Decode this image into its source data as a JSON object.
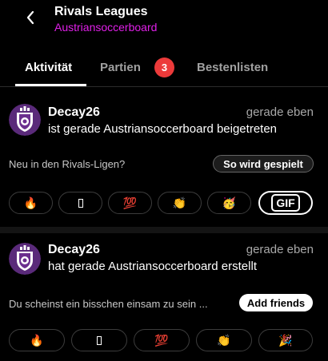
{
  "header": {
    "title": "Rivals Leagues",
    "subtitle": "Austriansoccerboard",
    "accent_color": "#e020e8"
  },
  "tabs": [
    {
      "label": "Aktivität",
      "active": true
    },
    {
      "label": "Partien",
      "active": false,
      "badge": "3"
    },
    {
      "label": "Bestenlisten",
      "active": false
    }
  ],
  "feed": [
    {
      "username": "Decay26",
      "time": "gerade eben",
      "message": "ist gerade Austriansoccerboard beigetreten",
      "hint": "Neu in den Rivals-Ligen?",
      "action_label": "So wird gespielt",
      "reactions": [
        "🔥",
        "▯",
        "💯",
        "👏",
        "🥳"
      ],
      "gif_label": "GIF"
    },
    {
      "username": "Decay26",
      "time": "gerade eben",
      "message": "hat gerade Austriansoccerboard erstellt",
      "hint": "Du scheinst ein bisschen einsam zu sein ...",
      "action_label": "Add friends",
      "reactions": [
        "🔥",
        "▯",
        "💯",
        "👏",
        "🎉"
      ]
    }
  ]
}
